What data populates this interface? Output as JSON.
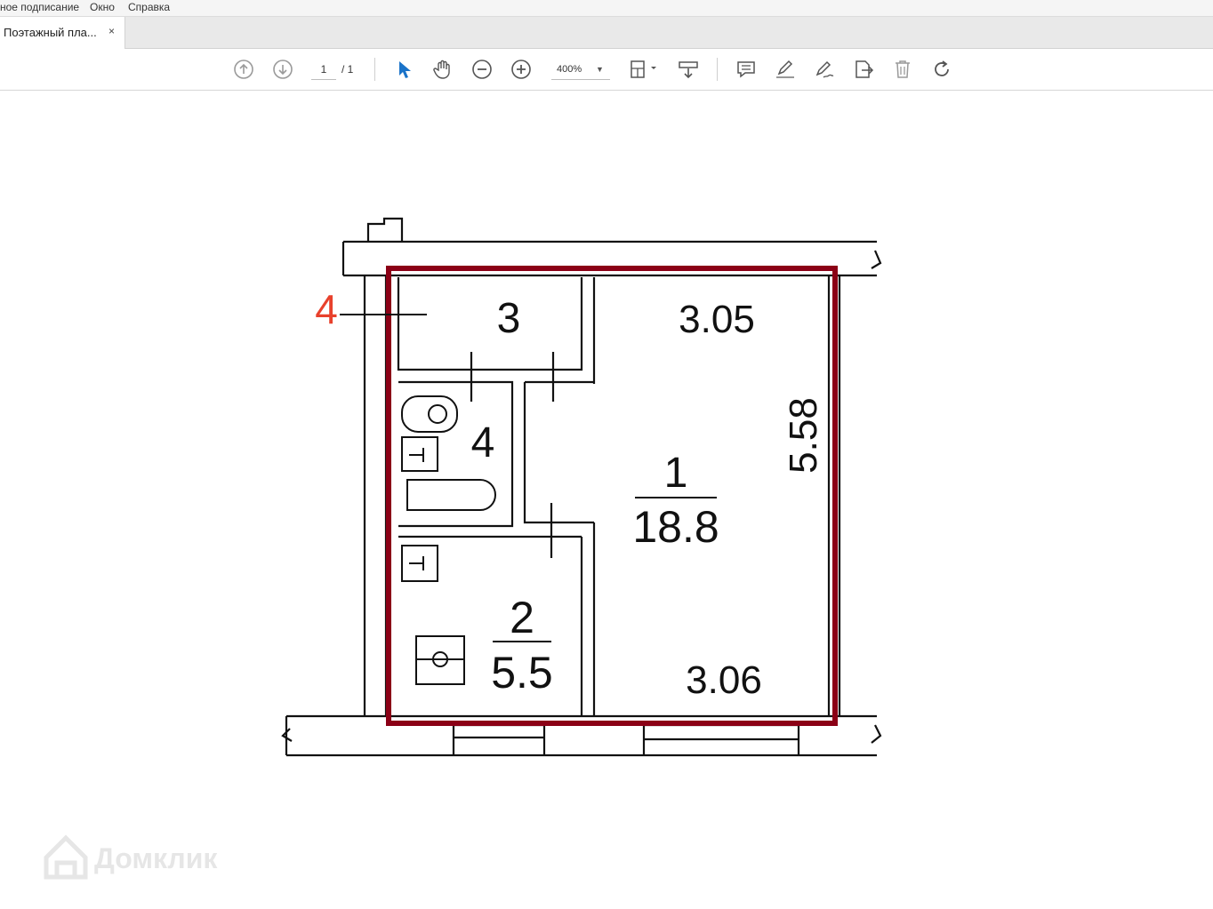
{
  "menu": {
    "items": [
      "ное подписание",
      "Окно",
      "Справка"
    ]
  },
  "tab": {
    "title": "Поэтажный пла...",
    "close": "×"
  },
  "toolbar": {
    "page_current": "1",
    "page_total": "/ 1",
    "zoom": "400%",
    "icons": [
      "prev-page-icon",
      "next-page-icon",
      "select-cursor-icon",
      "hand-tool-icon",
      "zoom-out-icon",
      "zoom-in-icon",
      "fit-page-icon",
      "scroll-mode-icon",
      "comment-icon",
      "highlight-icon",
      "sign-icon",
      "export-icon",
      "delete-icon",
      "rotate-icon"
    ]
  },
  "plan": {
    "marker": "4",
    "room3_label": "3",
    "room4_label": "4",
    "room1_number": "1",
    "room1_area": "18.8",
    "room2_number": "2",
    "room2_area": "5.5",
    "dim_top": "3.05",
    "dim_bottom": "3.06",
    "dim_side": "5.58",
    "highlight_color": "#8b0016",
    "marker_color": "#e8412c"
  },
  "watermark": {
    "text": "Домклик"
  }
}
